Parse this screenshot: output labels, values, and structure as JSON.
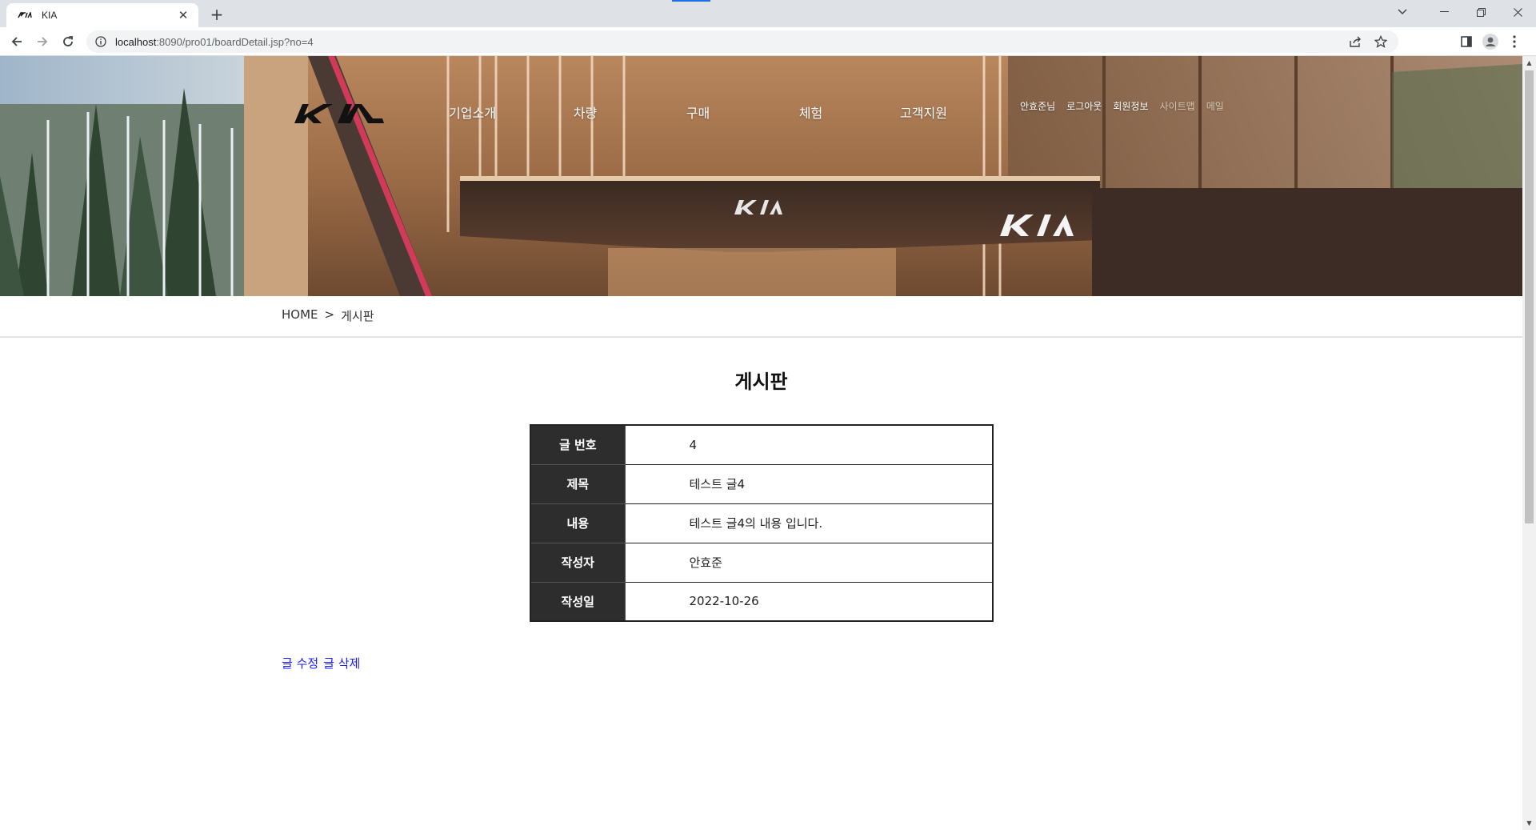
{
  "browser": {
    "tab_title": "KIA",
    "url_host": "localhost",
    "url_rest": ":8090/pro01/boardDetail.jsp?no=4",
    "new_tab_symbol": "+",
    "tab_close_symbol": "✕",
    "icons": [
      "back-icon",
      "forward-icon",
      "reload-icon",
      "info-icon",
      "share-icon",
      "star-icon",
      "side-panel-icon",
      "profile-icon",
      "menu-icon"
    ]
  },
  "header": {
    "logo_text": "KIA",
    "nav": [
      "기업소개",
      "차량",
      "구매",
      "체험",
      "고객지원"
    ],
    "util": [
      "안효준님",
      "로그아웃",
      "회원정보",
      "사이트맵",
      "메일"
    ]
  },
  "breadcrumb": {
    "home": "HOME",
    "separator": ">",
    "current": "게시판"
  },
  "board": {
    "title": "게시판",
    "rows": [
      {
        "label": "글 번호",
        "value": "4"
      },
      {
        "label": "제목",
        "value": "테스트 글4"
      },
      {
        "label": "내용",
        "value": "테스트 글4의 내용 입니다."
      },
      {
        "label": "작성자",
        "value": "안효준"
      },
      {
        "label": "작성일",
        "value": "2022-10-26"
      }
    ]
  },
  "actions": {
    "edit": "글 수정",
    "delete": "글 삭제"
  },
  "colors": {
    "link": "#1a1aff",
    "table_header_bg": "#2d2d2d",
    "chrome_bg": "#dee1e6"
  }
}
